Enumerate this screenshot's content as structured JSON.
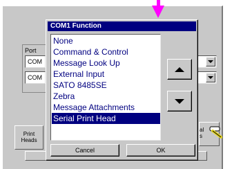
{
  "background_panel": {
    "port_label": "Port",
    "port_rows": [
      "COM",
      "COM"
    ],
    "bottom_tabs": [
      {
        "label": "Print\nHeads"
      },
      {
        "label": "al\ns"
      }
    ],
    "device_icon": "serial-cable-icon"
  },
  "dialog": {
    "title": "COM1 Function",
    "items": [
      "None",
      "Command & Control",
      "Message Look Up",
      "External Input",
      "SATO 8485SE",
      "Zebra",
      "Message Attachments",
      "Serial Print Head"
    ],
    "selected_index": 7,
    "scroll_up_icon": "triangle-up-icon",
    "scroll_down_icon": "triangle-down-icon",
    "cancel_label": "Cancel",
    "ok_label": "OK"
  },
  "colors": {
    "title_bar": "#000080",
    "selection": "#000080",
    "list_text": "#000080",
    "arrow": "#ff00ff",
    "face": "#c8c8c8"
  }
}
